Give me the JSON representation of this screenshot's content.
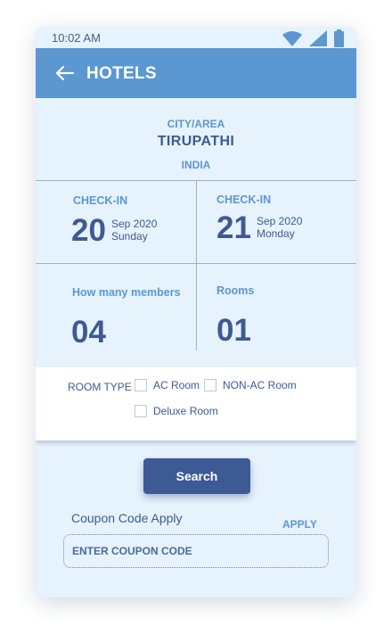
{
  "status_bar": {
    "time": "10:02 AM"
  },
  "app_bar": {
    "title": "HOTELS"
  },
  "location": {
    "label": "CITY/AREA",
    "city": "TIRUPATHI",
    "country": "INDIA"
  },
  "check_in_1": {
    "label": "CHECK-IN",
    "day": "20",
    "month_year": "Sep 2020",
    "weekday": "Sunday"
  },
  "check_in_2": {
    "label": "CHECK-IN",
    "day": "21",
    "month_year": "Sep 2020",
    "weekday": "Monday"
  },
  "members": {
    "label": "How many members",
    "value": "04"
  },
  "rooms": {
    "label": "Rooms",
    "value": "01"
  },
  "room_type": {
    "label": "ROOM TYPE",
    "options": [
      "AC Room",
      "NON-AC Room",
      "Deluxe Room"
    ]
  },
  "search": {
    "label": "Search"
  },
  "coupon": {
    "title": "Coupon Code Apply",
    "apply_label": "APPLY",
    "placeholder": "ENTER COUPON CODE",
    "value": ""
  },
  "colors": {
    "primary": "#5b97d1",
    "dark": "#3e5a94",
    "background": "#e6f2fc"
  }
}
